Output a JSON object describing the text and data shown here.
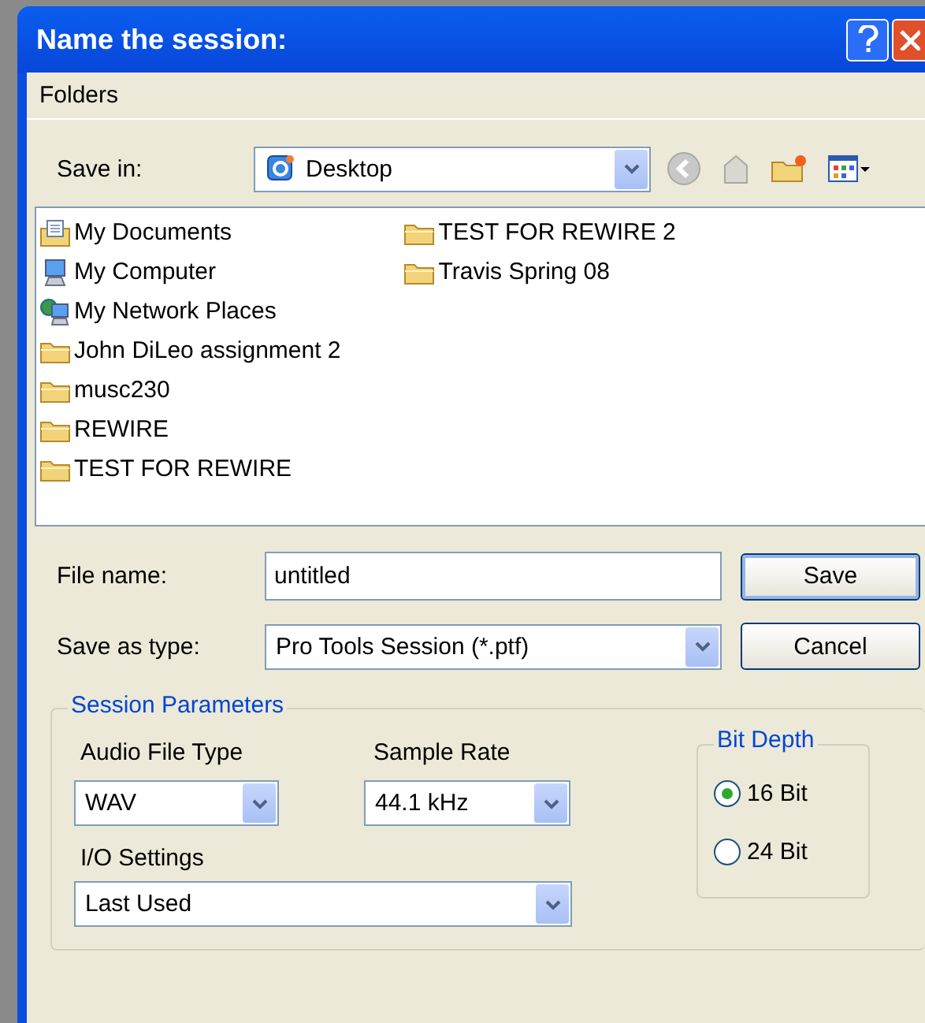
{
  "window": {
    "title": "Name the session:"
  },
  "menu": {
    "label": "Folders"
  },
  "save_in": {
    "label": "Save in:",
    "value": "Desktop"
  },
  "files": [
    {
      "name": "My Documents",
      "kind": "documents"
    },
    {
      "name": "My Computer",
      "kind": "computer"
    },
    {
      "name": "My Network Places",
      "kind": "network"
    },
    {
      "name": "John DiLeo assignment 2",
      "kind": "folder"
    },
    {
      "name": "musc230",
      "kind": "folder"
    },
    {
      "name": "REWIRE",
      "kind": "folder"
    },
    {
      "name": "TEST FOR REWIRE",
      "kind": "folder"
    },
    {
      "name": "TEST FOR REWIRE 2",
      "kind": "folder"
    },
    {
      "name": "Travis Spring 08",
      "kind": "folder"
    }
  ],
  "file_name": {
    "label": "File name:",
    "value": "untitled"
  },
  "save_as_type": {
    "label": "Save as type:",
    "value": "Pro Tools Session (*.ptf)"
  },
  "buttons": [
    "Save",
    "Cancel"
  ],
  "session_parameters": {
    "title": "Session Parameters",
    "audio_file_type": {
      "label": "Audio File Type",
      "value": "WAV"
    },
    "sample_rate": {
      "label": "Sample Rate",
      "value": "44.1 kHz"
    },
    "io_settings": {
      "label": "I/O Settings",
      "value": "Last Used"
    },
    "bit_depth": {
      "title": "Bit Depth",
      "options": [
        {
          "label": "16 Bit",
          "selected": true
        },
        {
          "label": "24 Bit",
          "selected": false
        }
      ]
    }
  }
}
